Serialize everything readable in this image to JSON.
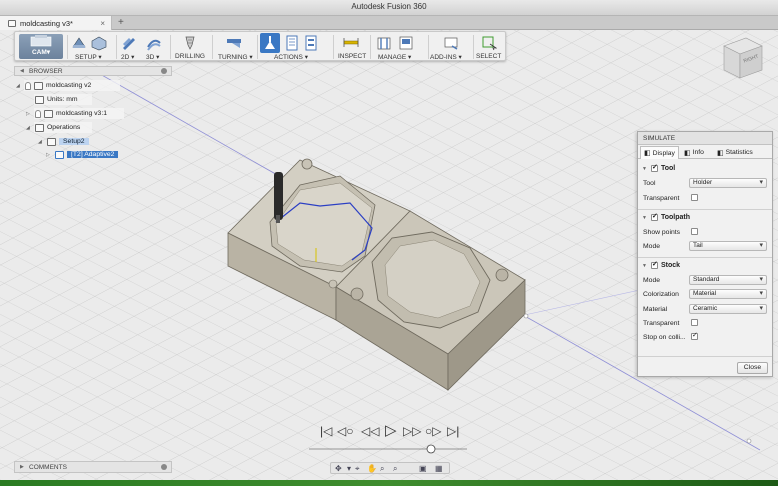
{
  "window": {
    "title": "Autodesk Fusion 360",
    "doc_tab": "moldcasting v3*",
    "close_glyph": "×",
    "add_tab_glyph": "+"
  },
  "toolbar": {
    "workspace": "CAM▾",
    "groups": [
      {
        "label": "SETUP ▾"
      },
      {
        "label": "2D ▾"
      },
      {
        "label": "3D ▾"
      },
      {
        "label": "DRILLING"
      },
      {
        "label": "TURNING ▾"
      },
      {
        "label": "ACTIONS ▾"
      },
      {
        "label": "INSPECT"
      },
      {
        "label": "MANAGE ▾"
      },
      {
        "label": "ADD-INS ▾"
      },
      {
        "label": "SELECT"
      }
    ]
  },
  "browser": {
    "title": "BROWSER",
    "items": [
      {
        "label": "moldcasting v2"
      },
      {
        "label": "Units: mm"
      },
      {
        "label": "moldcasting v3:1"
      },
      {
        "label": "Operations"
      },
      {
        "label": "Setup2"
      },
      {
        "label": "[T2] Adaptive2"
      }
    ]
  },
  "simulate": {
    "title": "SIMULATE",
    "tabs": [
      {
        "label": "Display"
      },
      {
        "label": "Info"
      },
      {
        "label": "Statistics"
      }
    ],
    "sections": {
      "tool": {
        "title": "Tool",
        "tool_label": "Tool",
        "tool_value": "Holder",
        "transparent_label": "Transparent"
      },
      "toolpath": {
        "title": "Toolpath",
        "show_points_label": "Show points",
        "mode_label": "Mode",
        "mode_value": "Tail"
      },
      "stock": {
        "title": "Stock",
        "mode_label": "Mode",
        "mode_value": "Standard",
        "colorization_label": "Colorization",
        "colorization_value": "Material",
        "material_label": "Material",
        "material_value": "Ceramic",
        "transparent_label": "Transparent",
        "stop_label": "Stop on colli..."
      }
    },
    "close_label": "Close"
  },
  "playback": {
    "buttons": [
      "|◁",
      "◁○",
      "◁◁",
      "▷",
      "▷▷",
      "○▷",
      "▷|"
    ]
  },
  "comments": {
    "title": "COMMENTS"
  },
  "viewcube": {
    "face_label": "RIGHT"
  },
  "colors": {
    "accent": "#3a78c4",
    "stock": "#c9c3b4",
    "toolpath": "#2b3fc4",
    "status_green": "#2a7b22"
  }
}
